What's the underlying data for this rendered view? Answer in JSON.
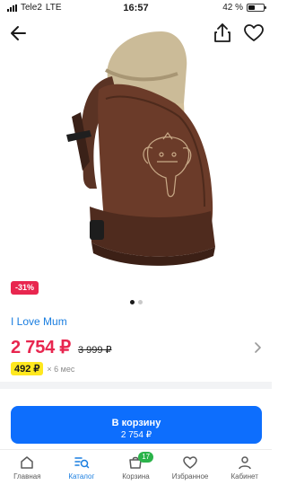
{
  "status_bar": {
    "carrier": "Tele2",
    "network": "LTE",
    "time": "16:57",
    "battery_text": "42 %",
    "battery_level": 0.42
  },
  "product": {
    "image_icon": "baby-carrier-image",
    "discount": "-31%",
    "gallery_count": 2,
    "gallery_active_index": 0,
    "shop_name": "I Love Mum",
    "price": "2 754 ₽",
    "old_price": "3 999 ₽",
    "installment_price": "492 ₽",
    "installment_term": "× 6 мес"
  },
  "cart_button": {
    "label": "В корзину",
    "price": "2 754 ₽"
  },
  "tabs": [
    {
      "label": "Главная",
      "icon": "home-icon",
      "active": false
    },
    {
      "label": "Каталог",
      "icon": "catalog-search-icon",
      "active": true
    },
    {
      "label": "Корзина",
      "icon": "cart-icon",
      "active": false,
      "badge": "17"
    },
    {
      "label": "Избранное",
      "icon": "heart-icon",
      "active": false
    },
    {
      "label": "Кабинет",
      "icon": "user-icon",
      "active": false
    }
  ],
  "colors": {
    "accent_blue": "#0d6efd",
    "link_blue": "#1a7ee0",
    "price_red": "#e8264f",
    "installment_yellow": "#ffe81f",
    "badge_green": "#2bb34a"
  }
}
